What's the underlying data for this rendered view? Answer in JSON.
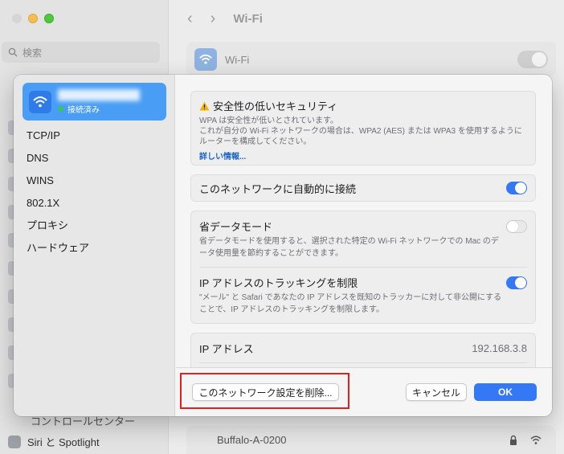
{
  "background": {
    "search_placeholder": "検索",
    "header_title": "Wi-Fi",
    "nav_back": "‹",
    "nav_forward": "›",
    "wifi_label": "Wi-Fi",
    "sidebar_bottom_item": "コントロールセンター",
    "sidebar_siri_item": "Siri と Spotlight",
    "network_row_name": "Buffalo-A-0200"
  },
  "sheet": {
    "network": {
      "name": "████████████",
      "status": "接続済み"
    },
    "sidebar_items": [
      "TCP/IP",
      "DNS",
      "WINS",
      "802.1X",
      "プロキシ",
      "ハードウェア"
    ],
    "warning": {
      "title": "安全性の低いセキュリティ",
      "line1": "WPA は安全性が低いとされています。",
      "line2": "これが自分の Wi-Fi ネットワークの場合は、WPA2 (AES) または WPA3 を使用するように",
      "line3": "ルーターを構成してください。",
      "link": "詳しい情報..."
    },
    "auto_join": {
      "label": "このネットワークに自動的に接続",
      "enabled": true
    },
    "low_data": {
      "label": "省データモード",
      "description": "省データモードを使用すると、選択された特定の Wi-Fi ネットワークでの Mac のデータ使用量を節約することができます。",
      "enabled": false
    },
    "limit_ip_tracking": {
      "label": "IP アドレスのトラッキングを制限",
      "description": "\"メール\" と Safari であなたの IP アドレスを既知のトラッカーに対して非公開にすることで、IP アドレスのトラッキングを制限します。",
      "enabled": true
    },
    "ip_address": {
      "label": "IP アドレス",
      "value": "192.168.3.8"
    },
    "footer": {
      "forget_button": "このネットワーク設定を削除...",
      "cancel_button": "キャンセル",
      "ok_button": "OK"
    }
  },
  "colors": {
    "accent": "#3478f6",
    "highlight": "#e0201c"
  }
}
